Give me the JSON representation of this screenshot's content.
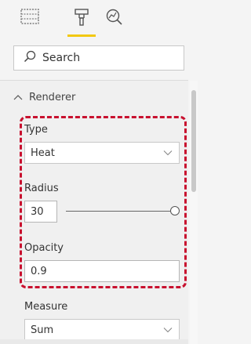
{
  "toolbar": {
    "tabs": [
      {
        "name": "fields",
        "icon": "table-icon",
        "active": false
      },
      {
        "name": "format",
        "icon": "paint-roller-icon",
        "active": true
      },
      {
        "name": "analytics",
        "icon": "analytics-icon",
        "active": false
      }
    ],
    "accent_color": "#f2c811"
  },
  "search": {
    "placeholder": "Search",
    "icon": "search-icon"
  },
  "section": {
    "title": "Renderer",
    "expanded": true
  },
  "renderer": {
    "type": {
      "label": "Type",
      "value": "Heat"
    },
    "radius": {
      "label": "Radius",
      "value": "30",
      "slider_level": 1.0
    },
    "opacity": {
      "label": "Opacity",
      "value": "0.9"
    }
  },
  "measure": {
    "label": "Measure",
    "value": "Sum"
  },
  "highlight_color": "#c8102e"
}
